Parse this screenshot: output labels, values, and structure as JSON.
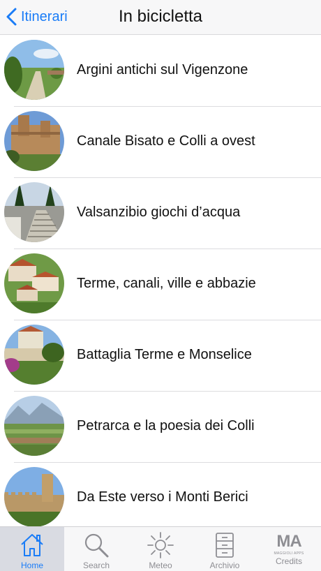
{
  "navbar": {
    "back_label": "Itinerari",
    "title": "In bicicletta",
    "accent_color": "#1a7cf7"
  },
  "routes": [
    {
      "label": "Argini antichi sul Vigenzone"
    },
    {
      "label": "Canale Bisato e Colli a ovest"
    },
    {
      "label": "Valsanzibio giochi d’acqua"
    },
    {
      "label": "Terme, canali, ville e abbazie"
    },
    {
      "label": "Battaglia Terme e Monselice"
    },
    {
      "label": "Petrarca e la poesia dei Colli"
    },
    {
      "label": "Da Este verso i Monti Berici"
    }
  ],
  "tabs": [
    {
      "label": "Home",
      "icon": "home-icon",
      "active": true
    },
    {
      "label": "Search",
      "icon": "search-icon",
      "active": false
    },
    {
      "label": "Meteo",
      "icon": "sun-icon",
      "active": false
    },
    {
      "label": "Archivio",
      "icon": "archive-icon",
      "active": false
    },
    {
      "label": "Credits",
      "icon": "ma-logo-icon",
      "active": false
    }
  ],
  "tab_logo_text": "MA",
  "tab_logo_subtext": "MAGGIOLI APPS"
}
